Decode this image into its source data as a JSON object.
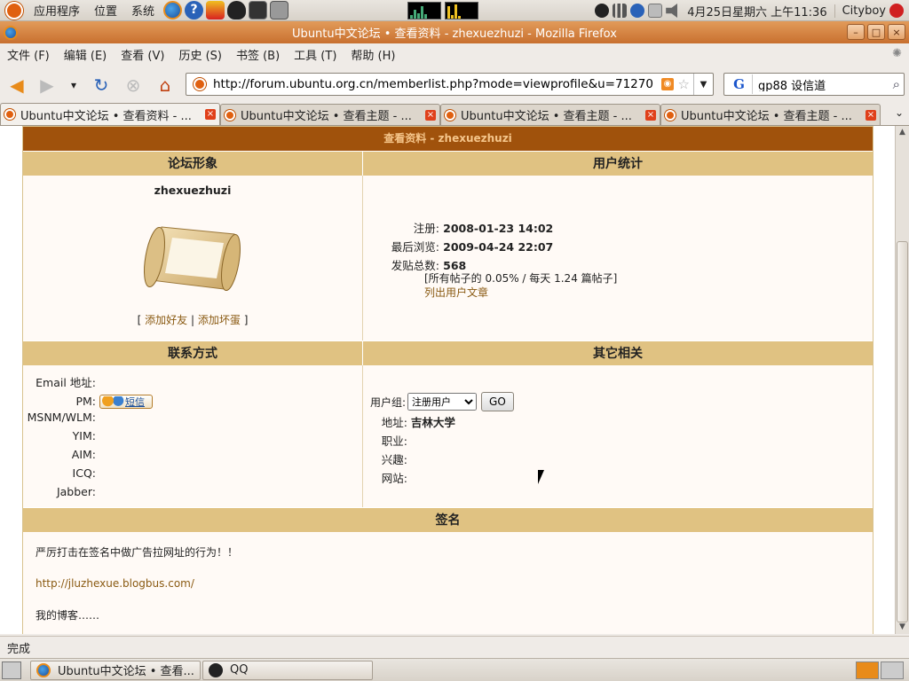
{
  "panel": {
    "apps": "应用程序",
    "places": "位置",
    "system": "系统",
    "clock": "4月25日星期六 上午11:36",
    "user": "Cityboy"
  },
  "window": {
    "title": "Ubuntu中文论坛 • 查看资料 - zhexuezhuzi - Mozilla Firefox",
    "min": "–",
    "max": "□",
    "close": "×"
  },
  "menubar": {
    "items": [
      "文件 (F)",
      "编辑 (E)",
      "查看 (V)",
      "历史 (S)",
      "书签 (B)",
      "工具 (T)",
      "帮助 (H)"
    ]
  },
  "navbar": {
    "url": "http://forum.ubuntu.org.cn/memberlist.php?mode=viewprofile&u=71270",
    "search_value": "gp88 设信道",
    "search_engine": "G"
  },
  "tabs": [
    {
      "label": "Ubuntu中文论坛 • 查看资料 - ...",
      "active": true
    },
    {
      "label": "Ubuntu中文论坛 • 查看主题 - ...",
      "active": false
    },
    {
      "label": "Ubuntu中文论坛 • 查看主题 - ...",
      "active": false
    },
    {
      "label": "Ubuntu中文论坛 • 查看主题 - ...",
      "active": false
    }
  ],
  "profile": {
    "header": "查看资料 - zhexuezhuzi",
    "avatar_section": "论坛形象",
    "stats_section": "用户统计",
    "username": "zhexuezhuzi",
    "add_friend": "添加好友",
    "add_foe": "添加坏蛋",
    "bracket_open": "[",
    "bracket_sep": "|",
    "bracket_close": "]",
    "stats": {
      "joined_label": "注册:",
      "joined": "2008-01-23 14:02",
      "last_visit_label": "最后浏览:",
      "last_visit": "2009-04-24 22:07",
      "posts_label": "发贴总数:",
      "posts": "568",
      "posts_detail": "[所有帖子的 0.05% / 每天 1.24 篇帖子]",
      "search_posts": "列出用户文章"
    },
    "contact_section": "联系方式",
    "other_section": "其它相关",
    "contact": {
      "email_label": "Email 地址:",
      "pm_label": "PM:",
      "pm_button": "短信",
      "msnm_label": "MSNM/WLM:",
      "yim_label": "YIM:",
      "aim_label": "AIM:",
      "icq_label": "ICQ:",
      "jabber_label": "Jabber:"
    },
    "other": {
      "group_label": "用户组:",
      "group_value": "注册用户",
      "go_button": "GO",
      "location_label": "地址:",
      "location": "吉林大学",
      "occupation_label": "职业:",
      "interests_label": "兴趣:",
      "website_label": "网站:"
    },
    "signature_section": "签名",
    "signature": {
      "line1": "严厉打击在签名中做广告拉网址的行为！！",
      "link": "http://jluzhexue.blogbus.com/",
      "line3": "我的博客……"
    }
  },
  "status": {
    "text": "完成"
  },
  "taskbar": {
    "items": [
      "Ubuntu中文论坛 • 查看...",
      "QQ"
    ]
  }
}
